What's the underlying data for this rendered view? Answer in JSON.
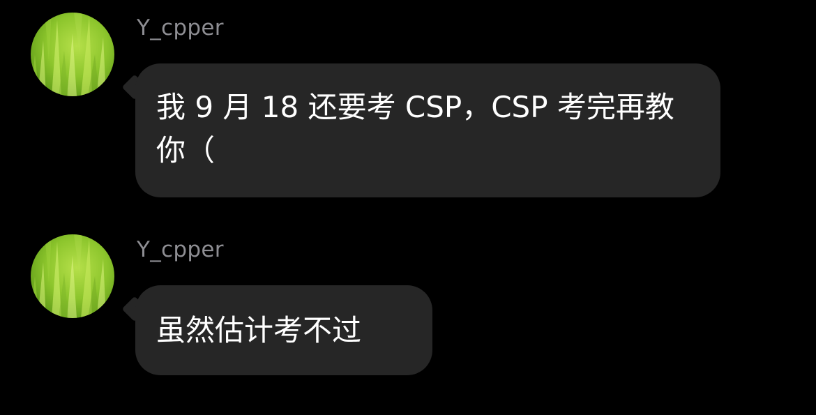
{
  "messages": [
    {
      "sender": "Y_cpper",
      "text": "我 9 月 18 还要考 CSP，CSP 考完再教你（",
      "avatar_icon": "grass-avatar-icon"
    },
    {
      "sender": "Y_cpper",
      "text": "虽然估计考不过",
      "avatar_icon": "grass-avatar-icon"
    }
  ],
  "colors": {
    "background": "#000000",
    "bubble": "#262626",
    "username": "#8e8e93",
    "text": "#ffffff"
  }
}
